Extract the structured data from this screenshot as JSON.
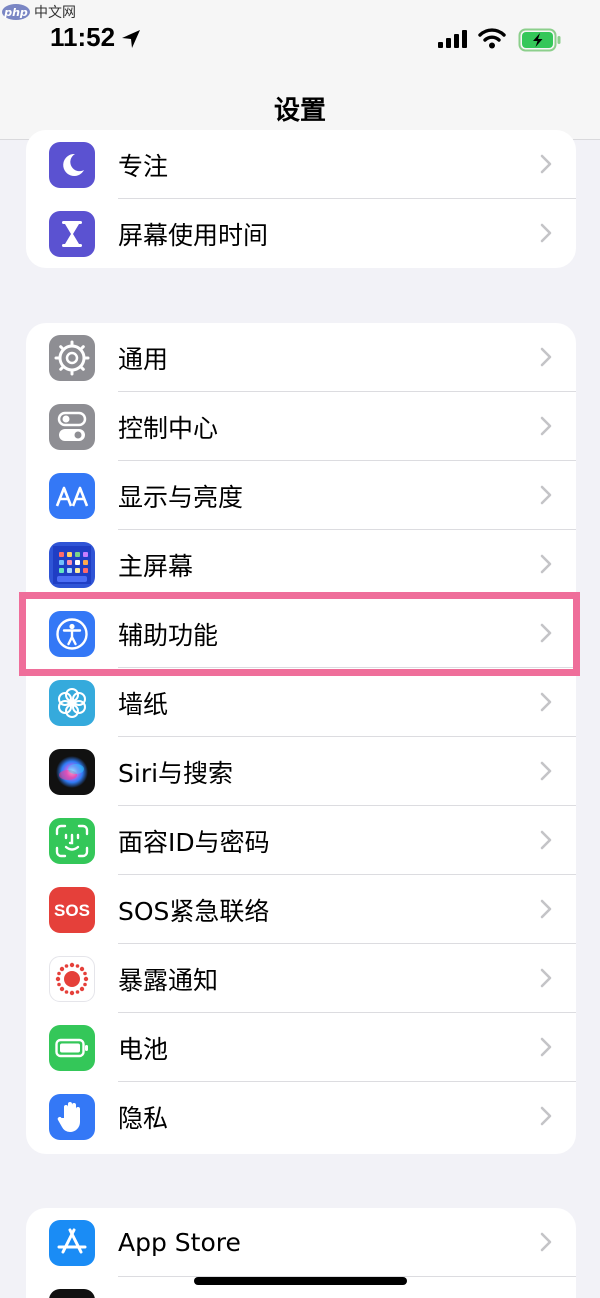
{
  "watermark": {
    "logo": "php",
    "text": "中文网"
  },
  "status_bar": {
    "time": "11:52"
  },
  "nav": {
    "title": "设置"
  },
  "groups": [
    {
      "items": [
        {
          "label": "专注",
          "icon": "moon-icon",
          "color": "#5b52d1"
        },
        {
          "label": "屏幕使用时间",
          "icon": "hourglass-icon",
          "color": "#5b52d1"
        }
      ]
    },
    {
      "items": [
        {
          "label": "通用",
          "icon": "gear-icon",
          "color": "#8e8e93"
        },
        {
          "label": "控制中心",
          "icon": "toggles-icon",
          "color": "#8e8e93"
        },
        {
          "label": "显示与亮度",
          "icon": "text-size-icon",
          "color": "#3478f6"
        },
        {
          "label": "主屏幕",
          "icon": "home-grid-icon",
          "color": "#2f54d6"
        },
        {
          "label": "辅助功能",
          "icon": "accessibility-icon",
          "color": "#3478f6"
        },
        {
          "label": "墙纸",
          "icon": "flower-icon",
          "color": "#35aadc"
        },
        {
          "label": "Siri与搜索",
          "icon": "siri-icon",
          "color": "#111111"
        },
        {
          "label": "面容ID与密码",
          "icon": "face-id-icon",
          "color": "#34c759"
        },
        {
          "label": "SOS紧急联络",
          "icon": "sos-icon",
          "color": "#e5403a"
        },
        {
          "label": "暴露通知",
          "icon": "exposure-icon",
          "color": "#ffffff"
        },
        {
          "label": "电池",
          "icon": "battery-icon",
          "color": "#34c759"
        },
        {
          "label": "隐私",
          "icon": "hand-icon",
          "color": "#3478f6"
        }
      ]
    },
    {
      "items": [
        {
          "label": "App Store",
          "icon": "app-store-icon",
          "color": "#1a8cf5"
        }
      ]
    }
  ],
  "highlight": {
    "target": "辅助功能",
    "color": "#ef6e9a"
  }
}
